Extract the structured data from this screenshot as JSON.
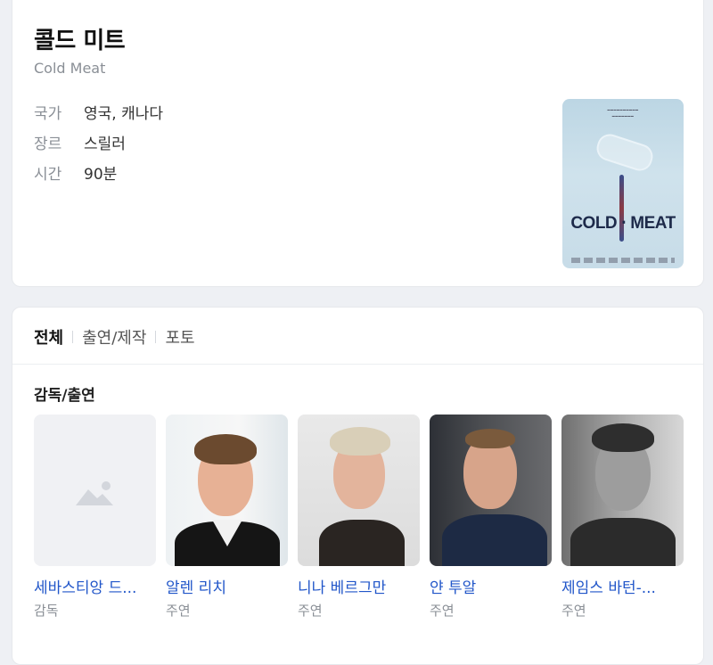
{
  "movie": {
    "title": "콜드 미트",
    "original_title": "Cold Meat",
    "info": [
      {
        "label": "국가",
        "value": "영국, 캐나다"
      },
      {
        "label": "장르",
        "value": "스릴러"
      },
      {
        "label": "시간",
        "value": "90분"
      }
    ],
    "poster": {
      "title_text": "COLD ⋅ MEAT"
    }
  },
  "tabs": [
    {
      "label": "전체",
      "active": true
    },
    {
      "label": "출연/제작",
      "active": false
    },
    {
      "label": "포토",
      "active": false
    }
  ],
  "section_title": "감독/출연",
  "people": [
    {
      "name": "세바스티앙 드...",
      "role": "감독",
      "photo": "placeholder-image-icon"
    },
    {
      "name": "알렌 리치",
      "role": "주연",
      "photo": "portrait"
    },
    {
      "name": "니나 베르그만",
      "role": "주연",
      "photo": "portrait"
    },
    {
      "name": "얀 투알",
      "role": "주연",
      "photo": "portrait"
    },
    {
      "name": "제임스 바턴-...",
      "role": "주연",
      "photo": "portrait"
    }
  ],
  "colors": {
    "link": "#2156c9",
    "muted": "#8a8f96",
    "background": "#eef0f4"
  }
}
